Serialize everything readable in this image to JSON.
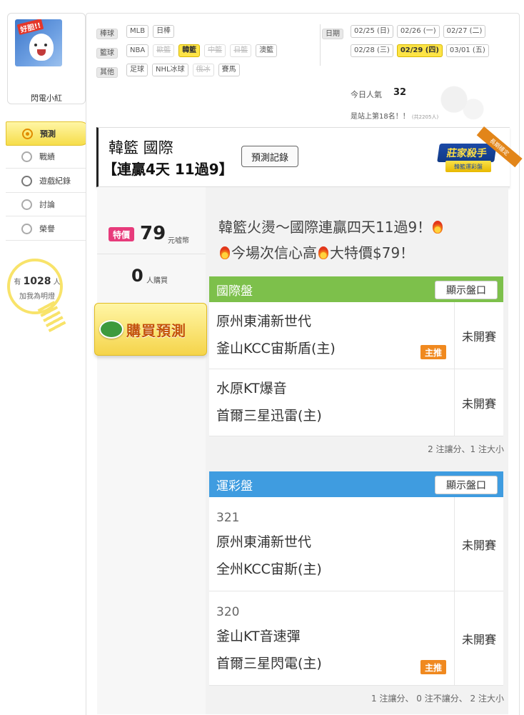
{
  "sidebar": {
    "avatar_badge": "好胆!!",
    "username": "閃電小紅",
    "menu": [
      {
        "label": "預測",
        "icon": "target-icon",
        "active": true
      },
      {
        "label": "戰績",
        "icon": "chart-icon",
        "active": false
      },
      {
        "label": "遊戲紀錄",
        "icon": "circle-icon",
        "active": false
      },
      {
        "label": "討論",
        "icon": "chat-icon",
        "active": false
      },
      {
        "label": "榮譽",
        "icon": "medal-icon",
        "active": false
      }
    ],
    "fans": {
      "prefix": "有",
      "count": "1028",
      "suffix": "人",
      "line2": "加我為明燈"
    }
  },
  "filters": {
    "rows": [
      {
        "label": "棒球",
        "items": [
          {
            "text": "MLB",
            "state": "normal"
          },
          {
            "text": "日棒",
            "state": "normal"
          }
        ]
      },
      {
        "label": "籃球",
        "items": [
          {
            "text": "NBA",
            "state": "normal"
          },
          {
            "text": "歐籃",
            "state": "off"
          },
          {
            "text": "韓籃",
            "state": "on"
          },
          {
            "text": "中籃",
            "state": "off"
          },
          {
            "text": "日籃",
            "state": "off"
          },
          {
            "text": "澳籃",
            "state": "normal"
          }
        ]
      },
      {
        "label": "其他",
        "items": [
          {
            "text": "足球",
            "state": "normal"
          },
          {
            "text": "NHL冰球",
            "state": "normal"
          },
          {
            "text": "俄冰",
            "state": "off"
          },
          {
            "text": "賽馬",
            "state": "normal"
          }
        ]
      }
    ],
    "date_label": "日期",
    "dates": [
      {
        "text": "02/25 (日)",
        "state": "normal"
      },
      {
        "text": "02/26 (一)",
        "state": "normal"
      },
      {
        "text": "02/27 (二)",
        "state": "normal"
      },
      {
        "text": "02/28 (三)",
        "state": "normal"
      },
      {
        "text": "02/29 (四)",
        "state": "on"
      },
      {
        "text": "03/01 (五)",
        "state": "normal"
      }
    ],
    "popularity_label": "今日人氣",
    "popularity_value": "32",
    "rank_text": "是站上第18名！！",
    "rank_total": "(共2205人)"
  },
  "title": {
    "line1": "韓籃 國際",
    "line2": "【連贏4天 11過9】",
    "record_button": "預測記錄",
    "badge_main": "莊家殺手",
    "badge_sub": "韓籃運彩盤",
    "ribbon": "長期穩定"
  },
  "purchase": {
    "special_tag": "特價",
    "price": "79",
    "price_unit": "元嘘幣",
    "buyers": "0",
    "buyers_unit": "人購買",
    "buy_button": "購買預測"
  },
  "headline": {
    "line1": "韓籃火燙～國際連贏四天11過9！",
    "line2a": "今場次信心高",
    "line2b": "大特價$79！"
  },
  "boards": [
    {
      "title": "國際盤",
      "show_button": "顯示盤口",
      "color": "#7dc04b",
      "games": [
        {
          "number": "",
          "away": "原州東浦新世代",
          "home": "釜山KCC宙斯盾(主)",
          "status": "未開賽",
          "tag": "主推"
        },
        {
          "number": "",
          "away": "水原KT爆音",
          "home": "首爾三星迅雷(主)",
          "status": "未開賽",
          "tag": ""
        }
      ],
      "summary": "2 注讓分、1 注大小"
    },
    {
      "title": "運彩盤",
      "show_button": "顯示盤口",
      "color": "#3f9ce0",
      "games": [
        {
          "number": "321",
          "away": "原州東浦新世代",
          "home": "全州KCC宙斯(主)",
          "status": "未開賽",
          "tag": ""
        },
        {
          "number": "320",
          "away": "釜山KT音速彈",
          "home": "首爾三星閃電(主)",
          "status": "未開賽",
          "tag": "主推"
        }
      ],
      "summary": "1 注讓分、 0 注不讓分、 2 注大小"
    }
  ]
}
